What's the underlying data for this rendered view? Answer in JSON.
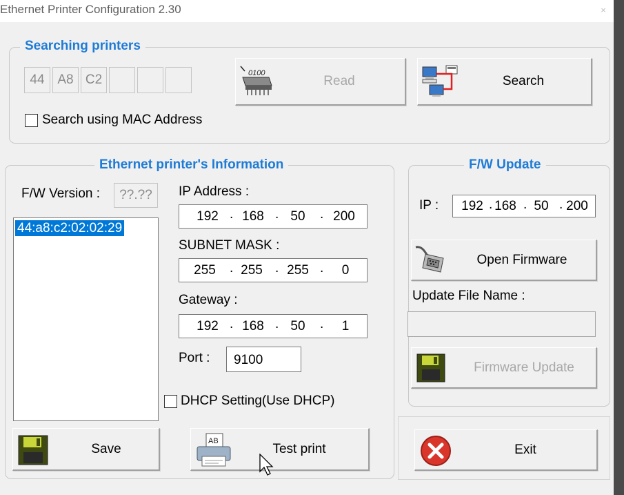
{
  "window": {
    "title": "Ethernet Printer Configuration 2.30",
    "close_glyph": "×"
  },
  "searching": {
    "legend": "Searching printers",
    "mac_fields": [
      "44",
      "A8",
      "C2",
      "",
      "",
      ""
    ],
    "read_label": "Read",
    "search_label": "Search",
    "mac_checkbox_label": "Search using MAC Address",
    "mac_checkbox_checked": false
  },
  "info": {
    "legend": "Ethernet printer's Information",
    "fw_version_label": "F/W Version :",
    "fw_version_value": "??.??",
    "printers": [
      "44:a8:c2:02:02:29"
    ],
    "ip_label": "IP Address :",
    "ip": [
      "192",
      "168",
      "50",
      "200"
    ],
    "subnet_label": "SUBNET MASK :",
    "subnet": [
      "255",
      "255",
      "255",
      "0"
    ],
    "gateway_label": "Gateway :",
    "gateway": [
      "192",
      "168",
      "50",
      "1"
    ],
    "port_label": "Port :",
    "port": "9100",
    "dhcp_label": "DHCP Setting(Use DHCP)",
    "dhcp_checked": false,
    "save_label": "Save",
    "test_print_label": "Test print",
    "ip_separator": "."
  },
  "fw_update": {
    "legend": "F/W Update",
    "ip_label": "IP :",
    "ip": [
      "192",
      "168",
      "50",
      "200"
    ],
    "open_firmware_label": "Open Firmware",
    "update_file_label": "Update File Name :",
    "update_file_value": "",
    "firmware_update_label": "Firmware Update",
    "ip_separator": "."
  },
  "exit_label": "Exit",
  "colors": {
    "legend": "#1e7bd6",
    "selection": "#0078d7",
    "exit_red": "#d9352b"
  }
}
